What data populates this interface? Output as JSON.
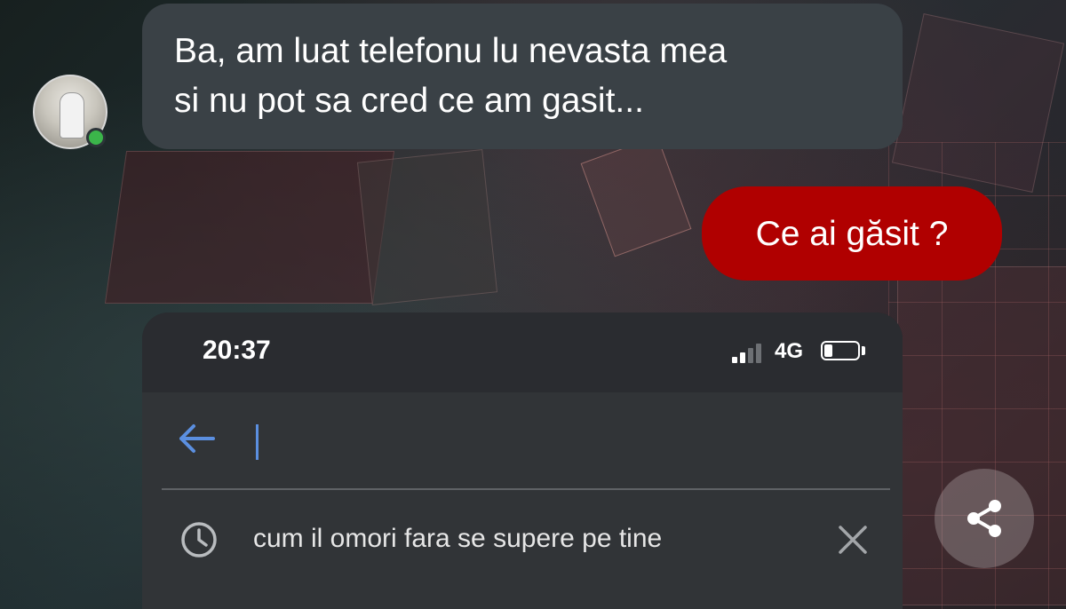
{
  "conversation": {
    "incoming": {
      "lines": [
        "Ba, am luat telefonu lu nevasta mea",
        "si nu pot sa cred ce am gasit..."
      ],
      "sender_status": "online"
    },
    "outgoing": {
      "text": "Ce ai găsit ?"
    }
  },
  "screenshot": {
    "status_bar": {
      "time": "20:37",
      "network": "4G",
      "signal_bars": 2,
      "signal_bars_total": 4,
      "battery_level": 0.25
    },
    "search": {
      "query": "",
      "back_icon": "arrow-left-icon",
      "history": [
        {
          "text": "cum il omori fara se supere pe tine",
          "icon": "clock-icon",
          "remove_icon": "close-icon"
        }
      ]
    }
  },
  "actions": {
    "share_icon": "share-icon"
  },
  "colors": {
    "incoming_bubble": "#3a4146",
    "outgoing_bubble": "#b00000",
    "online_dot": "#3bb54a",
    "cursor": "#5b8fe0"
  }
}
